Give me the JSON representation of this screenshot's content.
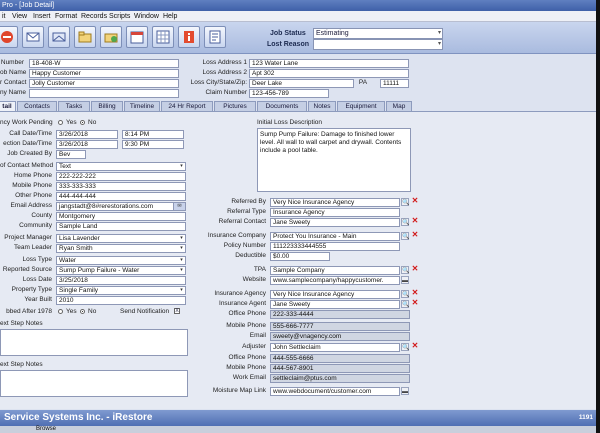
{
  "window": {
    "title": "Pro - [Job Detail]"
  },
  "menu": [
    "it",
    "View",
    "Insert",
    "Format",
    "Records",
    "Scripts",
    "Window",
    "Help"
  ],
  "toolbar": {
    "buttons": [
      "no-entry-icon",
      "mail-icon",
      "envelope-icon",
      "folder-icon",
      "add-folder-icon",
      "calendar-icon",
      "spreadsheet-icon",
      "info-icon",
      "note-icon"
    ],
    "job_status_label": "Job Status",
    "job_status_value": "Estimating",
    "lost_reason_label": "Lost Reason",
    "lost_reason_value": ""
  },
  "top": {
    "number_label": "Number",
    "number": "18-408-W",
    "job_name_label": "ob Name",
    "job_name": "Happy Customer",
    "contact_label": "r Contact",
    "contact": "Jolly Customer",
    "company_label": "ny Name",
    "company": "",
    "loss_address1_label": "Loss Address 1",
    "loss_address1": "123 Water Lane",
    "loss_address2_label": "Loss Address 2",
    "loss_address2": "Apt 302",
    "loss_city_label": "Loss City/State/Zip:",
    "loss_city": "Deer Lake",
    "loss_state": "PA",
    "loss_zip": "11111",
    "claim_label": "Claim Number",
    "claim": "123-456-789"
  },
  "tabs": [
    "tail",
    "Contacts",
    "Tasks",
    "Billing",
    "Timeline",
    "24 Hr Report",
    "Pictures",
    "Documents",
    "Notes",
    "Equipment",
    "Map"
  ],
  "detail": {
    "emergency_label": "ncy Work Pending",
    "emergency_yes": "Yes",
    "emergency_no": "No",
    "call_label": "Call Date/Time",
    "call_date": "3/26/2018",
    "call_time": "8:14 PM",
    "inspection_label": "ection Date/Time",
    "inspection_date": "3/26/2018",
    "inspection_time": "9:30 PM",
    "created_by_label": "Job Created By",
    "created_by": "Bev",
    "contact_method_label": "of Contact Method",
    "contact_method": "Text",
    "home_phone_label": "Home Phone",
    "home_phone": "222-222-222",
    "mobile_phone_label": "Mobile Phone",
    "mobile_phone": "333-333-333",
    "other_phone_label": "Other Phone",
    "other_phone": "444-444-444",
    "email_label": "Email Address",
    "email": "jangstadt@8#rerestorations.com",
    "county_label": "County",
    "county": "Montgomery",
    "community_label": "Community",
    "community": "Sample Land",
    "pm_label": "Project Manager",
    "pm": "Lisa Lavender",
    "team_leader_label": "Team Leader",
    "team_leader": "Ryan Smith",
    "loss_type_label": "Loss Type",
    "loss_type": "Water",
    "reported_source_label": "Reported Source",
    "reported_source": "Sump Pump Failure - Water",
    "loss_date_label": "Loss Date",
    "loss_date": "3/25/2018",
    "property_type_label": "Property Type",
    "property_type": "Single Family",
    "year_built_label": "Year Built",
    "year_built": "2010",
    "built_after_label": "bbed After 1978",
    "built_after_yes": "Yes",
    "built_after_no": "No",
    "send_notification_label": "Send Notification",
    "send_notification_mark": "X",
    "next_step_notes_label1": "ext Step Notes",
    "next_step_notes_label2": "ext Step Notes"
  },
  "loss": {
    "description_label": "Initial Loss Description",
    "description": "Sump Pump Failure: Damage to finished lower level.  All wall to wall carpet and drywall.  Contents include a pool table."
  },
  "right": {
    "referred_by_label": "Referred By",
    "referred_by": "Very Nice Insurance Agency",
    "referral_type_label": "Referral Type",
    "referral_type": "Insurance Agency",
    "referral_contact_label": "Referral Contact",
    "referral_contact": "Jane Sweety",
    "insurance_company_label": "Insurance Company",
    "insurance_company": "Protect You Insurance - Main",
    "policy_label": "Policy Number",
    "policy": "111223333444555",
    "deductible_label": "Deductible",
    "deductible": "$0.00",
    "tpa_label": "TPA",
    "tpa": "Sample Company",
    "website_label": "Website",
    "website": "www.samplecompany/happycustomer.",
    "ins_agency_label": "Insurance Agency",
    "ins_agency": "Very Nice Insurance Agency",
    "ins_agent_label": "Insurance Agent",
    "ins_agent": "Jane Sweety",
    "office_phone_label": "Office Phone",
    "office_phone": "222-333-4444",
    "mobile_phone_label": "Mobile Phone",
    "mobile_phone": "555-666-7777",
    "email_label": "Email",
    "email": "sweety@vnagency.com",
    "adjuster_label": "Adjuster",
    "adjuster": "John Settleclaim",
    "adj_office_label": "Office Phone",
    "adj_office": "444-555-6666",
    "adj_mobile_label": "Mobile Phone",
    "adj_mobile": "444-567-8901",
    "work_email_label": "Work Email",
    "work_email": "settleclaim@ptus.com",
    "moisture_label": "Moisture Map Link",
    "moisture": "www.webdocument/customer.com"
  },
  "footer": {
    "company": "Service Systems Inc. - iRestore",
    "build": "1191",
    "browse": "Browse"
  }
}
